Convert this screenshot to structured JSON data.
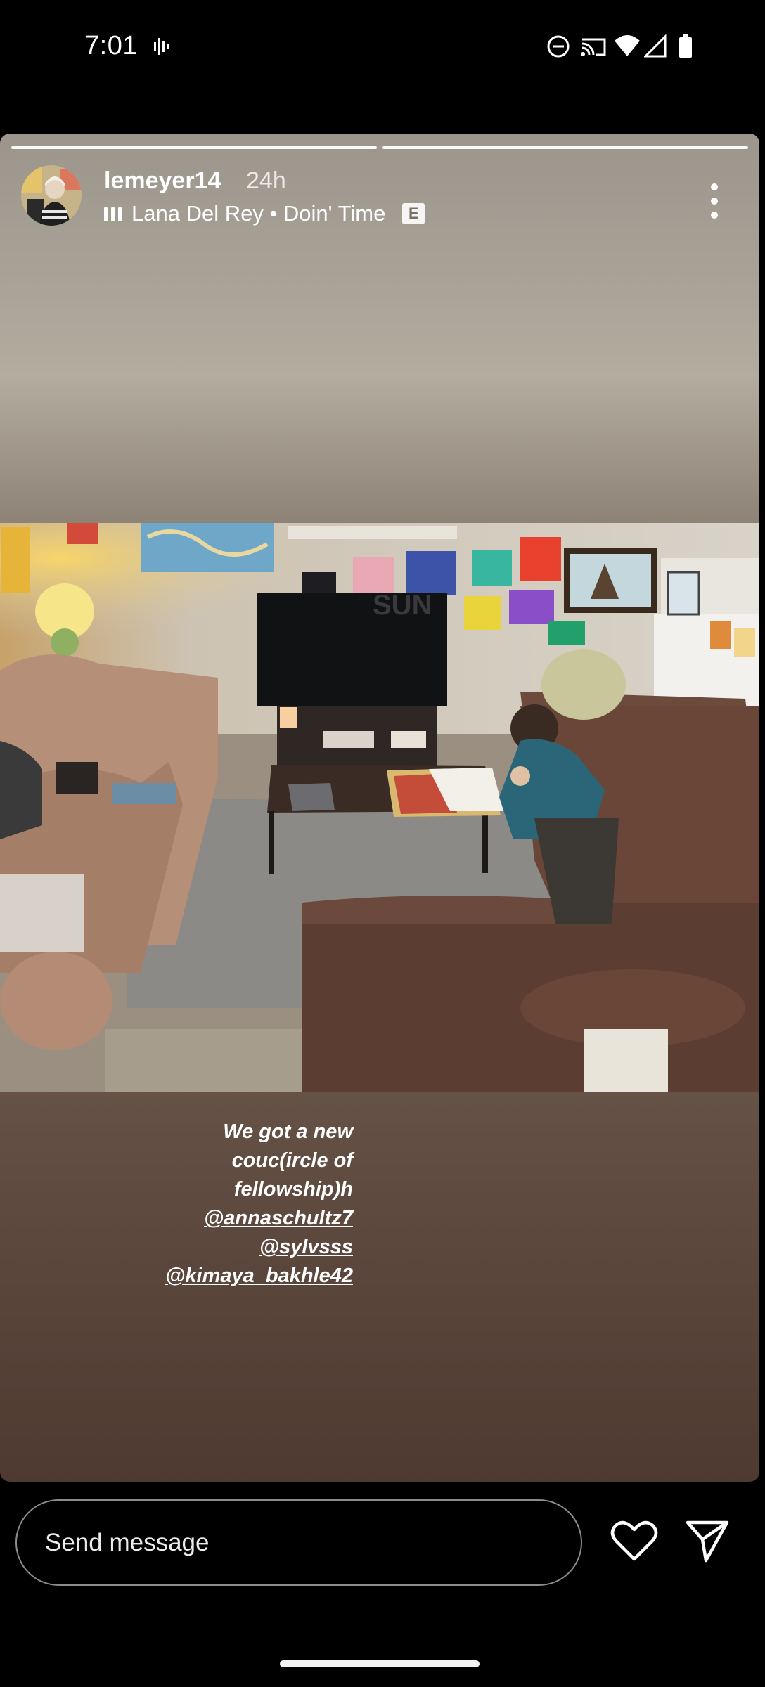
{
  "status_bar": {
    "time": "7:01",
    "icons": [
      "voice-activity-icon",
      "do-not-disturb-icon",
      "cast-icon",
      "wifi-icon",
      "cell-signal-icon",
      "battery-icon"
    ]
  },
  "story": {
    "progress": {
      "segments": 2,
      "active_index": 0
    },
    "user": {
      "username": "lemeyer14",
      "timestamp": "24h"
    },
    "music": {
      "text": "Lana Del Rey • Doin' Time",
      "explicit_badge": "E"
    },
    "caption": {
      "lines": [
        "We got a new",
        "couc(ircle of",
        "fellowship)h"
      ],
      "mentions": [
        "@annaschultz7",
        "@sylvsss",
        "@kimaya_bakhle42"
      ]
    },
    "photo_tv_text": "SUN"
  },
  "reply": {
    "placeholder": "Send message"
  },
  "icons": {
    "like": "heart-icon",
    "share": "send-icon",
    "more": "more-vertical-icon"
  }
}
